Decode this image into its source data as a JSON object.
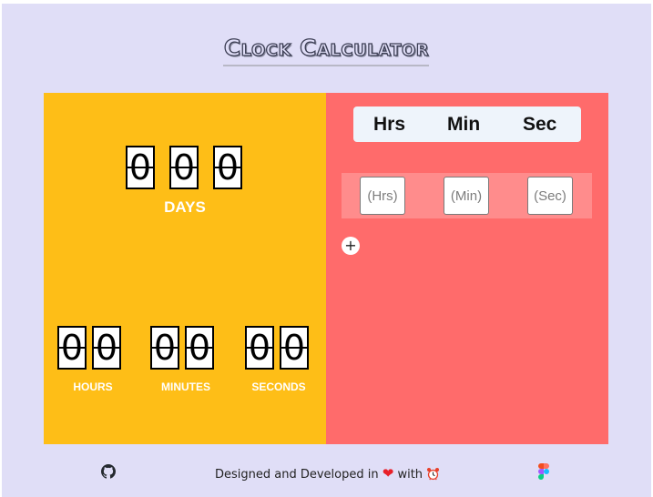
{
  "app": {
    "title": "Clock Calculator"
  },
  "result": {
    "days": {
      "digits": [
        "0",
        "0",
        "0"
      ],
      "label": "DAYS"
    },
    "hours": {
      "digits": [
        "0",
        "0"
      ],
      "label": "HOURS"
    },
    "minutes": {
      "digits": [
        "0",
        "0"
      ],
      "label": "MINUTES"
    },
    "seconds": {
      "digits": [
        "0",
        "0"
      ],
      "label": "SECONDS"
    }
  },
  "calculator": {
    "headers": [
      "Hrs",
      "Min",
      "Sec"
    ],
    "inputs": [
      {
        "value": "",
        "placeholder": "(Hrs)"
      },
      {
        "value": "",
        "placeholder": "(Min)"
      },
      {
        "value": "",
        "placeholder": "(Sec)"
      }
    ],
    "add_label": "+"
  },
  "footer": {
    "text_before": "Designed and Developed in",
    "text_with": "with",
    "icons": [
      "github-icon",
      "heart-icon",
      "alarm-clock-icon",
      "figma-icon"
    ]
  },
  "colors": {
    "background": "#e0def7",
    "result_panel": "#febe17",
    "calculator_panel": "#ff6b6b",
    "input_row": "#ff8c8c",
    "header_box": "#eef4fb"
  }
}
